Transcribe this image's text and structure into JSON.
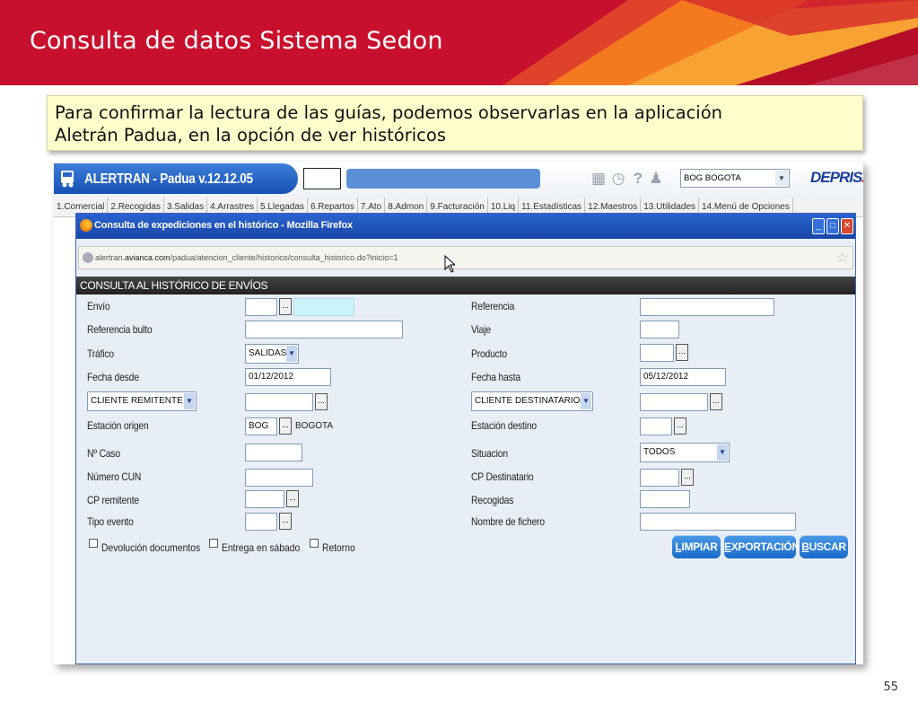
{
  "slide": {
    "title": "Consulta de datos Sistema Sedon",
    "callout_line1": "Para confirmar la lectura de las guías, podemos observarlas en la aplicación",
    "callout_line2": "Aletrán Padua, en la opción de ver históricos",
    "page_number": "55",
    "colors": {
      "banner": "#c8102e",
      "accent": "#f7941d",
      "callout_bg": "#ffffcc"
    }
  },
  "app": {
    "title": "ALERTRAN - Padua  v.12.12.05",
    "branch_select": "BOG BOGOTA",
    "brand": "DEPRISA",
    "header_icons": [
      "calculator-icon",
      "clock-icon",
      "help-icon",
      "user-icon"
    ],
    "tabs": [
      "1.Comercial",
      "2.Recogidas",
      "3.Salidas",
      "4.Arrastres",
      "5.Llegadas",
      "6.Repartos",
      "7.Ato",
      "8.Admon",
      "9.Facturación",
      "10.Liq",
      "11.Estadísticas",
      "12.Maestros",
      "13.Utilidades",
      "14.Menú de Opciones"
    ]
  },
  "popup": {
    "window_title": "Consulta de expediciones en el histórico - Mozilla Firefox",
    "url_prefix": "alertran.",
    "url_domain": "avianca.com",
    "url_path": "/padua/atencion_cliente/historico/consulta_historico.do?inicio=1",
    "section_title": "CONSULTA AL HISTÓRICO DE ENVÍOS",
    "labels": {
      "envio": "Envío",
      "referencia_bulto": "Referencia bulto",
      "trafico": "Tráfico",
      "fecha_desde": "Fecha desde",
      "estacion_origen": "Estación origen",
      "caso": "Nº Caso",
      "numero_cun": "Número CUN",
      "cp_remitente": "CP remitente",
      "tipo_evento": "Tipo evento",
      "referencia": "Referencia",
      "viaje": "Viaje",
      "producto": "Producto",
      "fecha_hasta": "Fecha hasta",
      "estacion_destino": "Estación destino",
      "situacion": "Situacion",
      "cp_destinatario": "CP Destinatario",
      "recogidas": "Recogidas",
      "nombre_fichero": "Nombre de fichero"
    },
    "values": {
      "trafico": "SALIDAS",
      "fecha_desde": "01/12/2012",
      "fecha_hasta": "05/12/2012",
      "remitente_type": "CLIENTE REMITENTE",
      "destinatario_type": "CLIENTE DESTINATARIO",
      "estacion_origen_code": "BOG",
      "estacion_origen_name": "BOGOTA",
      "situacion": "TODOS"
    },
    "lookup_label": "...",
    "checkboxes": [
      "Devolución documentos",
      "Entrega en sábado",
      "Retorno"
    ],
    "buttons": {
      "limpiar_key": "L",
      "limpiar_rest": "IMPIAR",
      "export_key": "E",
      "export_rest": "XPORTACIÓN",
      "buscar_key": "B",
      "buscar_rest": "USCAR"
    }
  }
}
